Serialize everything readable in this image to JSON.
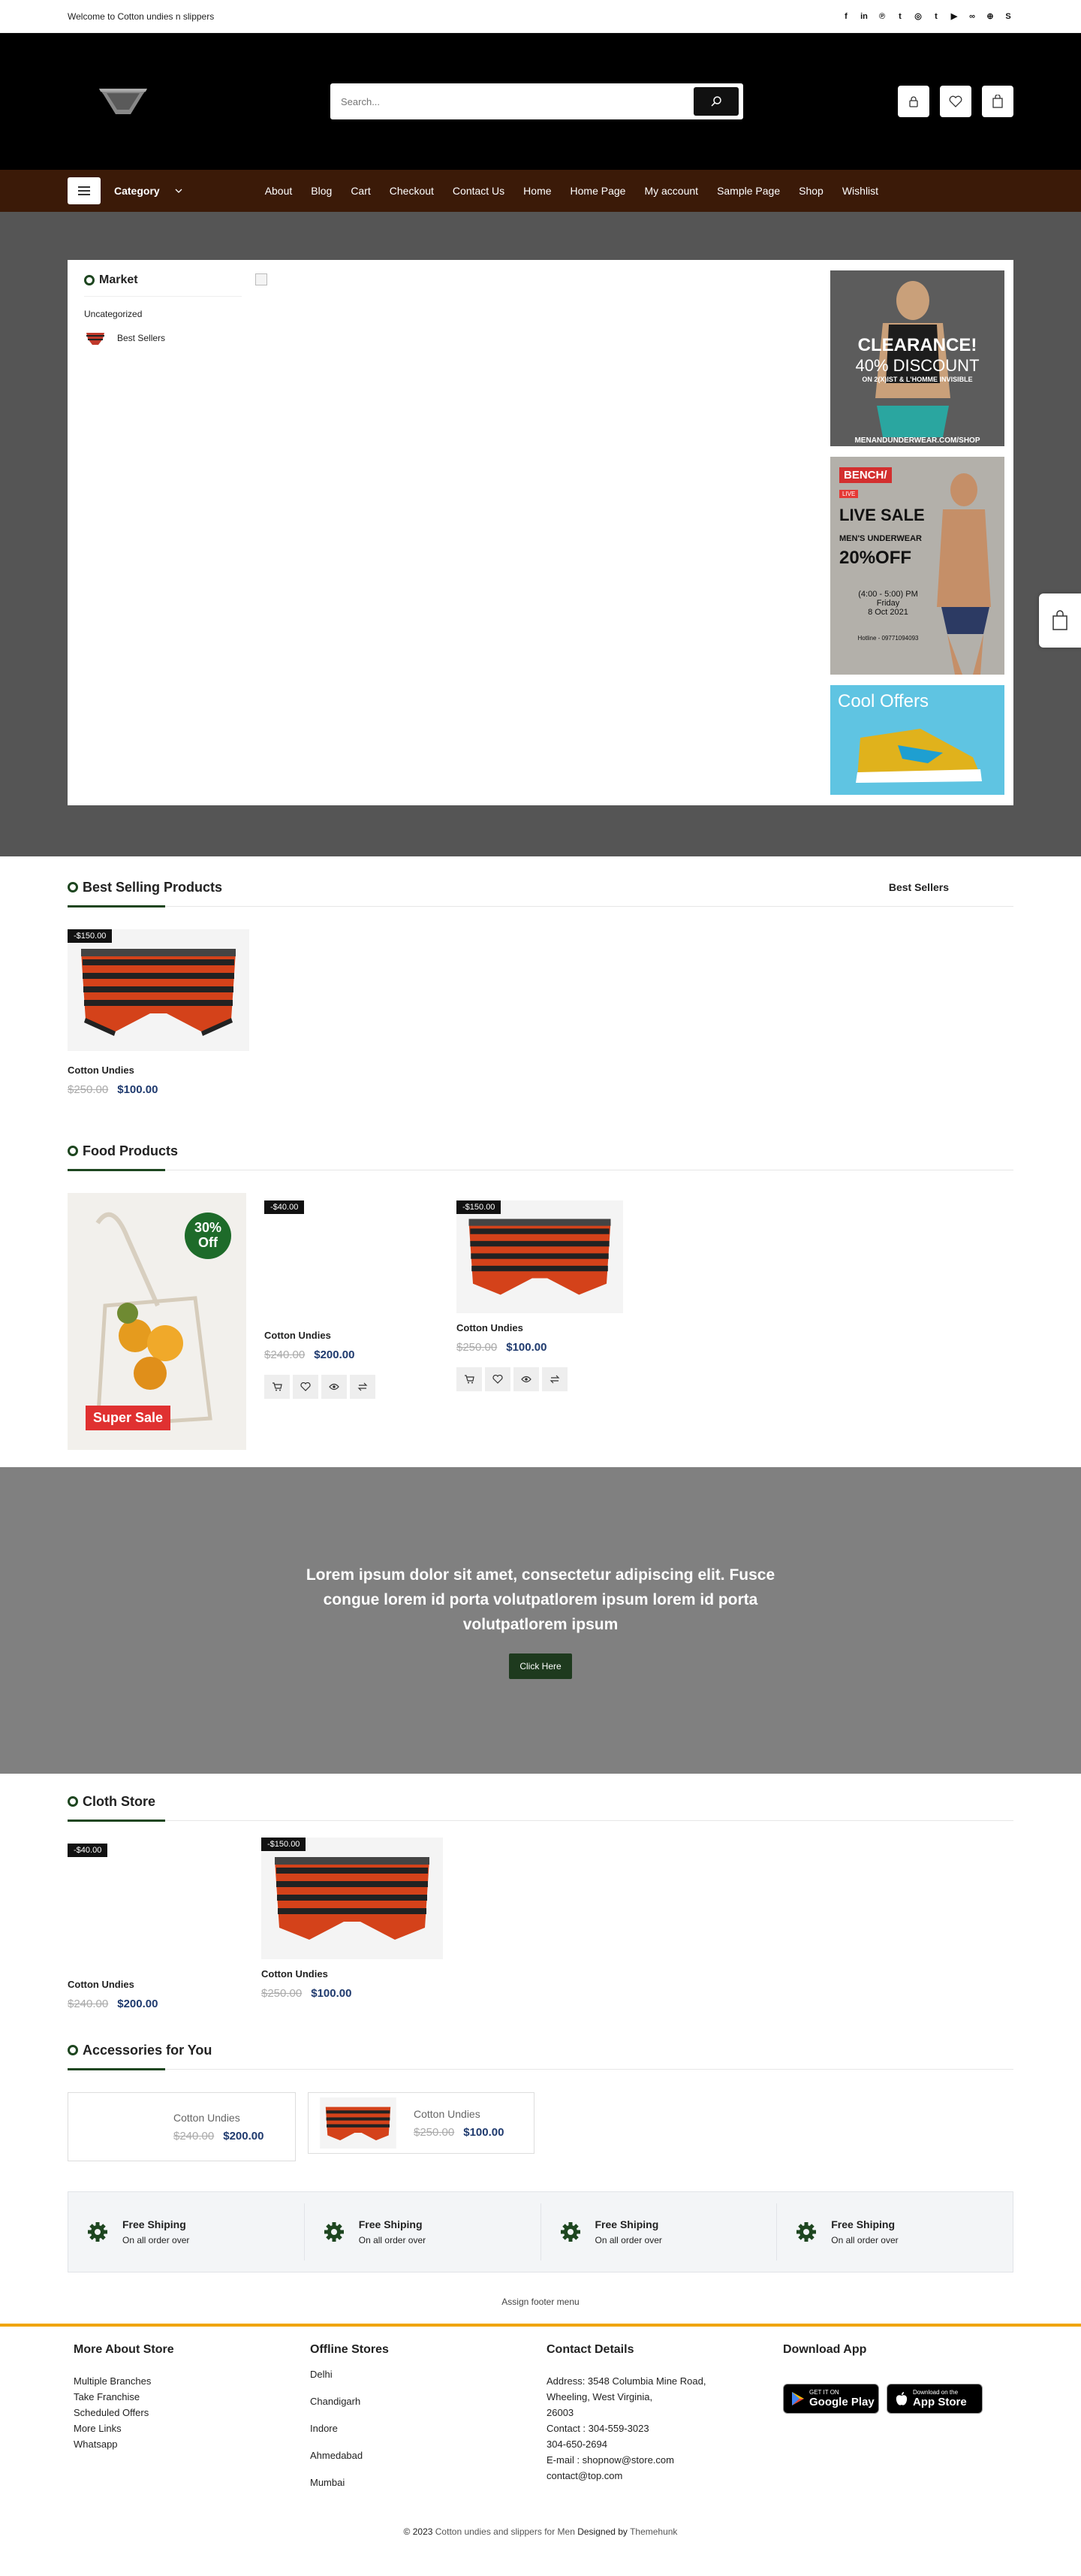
{
  "topbar": {
    "welcome": "Welcome to Cotton undies n slippers"
  },
  "social_icons": [
    "facebook-icon",
    "linkedin-icon",
    "pinterest-icon",
    "twitter-icon",
    "instagram-icon",
    "tumblr-icon",
    "youtube-icon",
    "flickr-icon",
    "dribbble-icon",
    "skype-icon"
  ],
  "header": {
    "search_placeholder": "Search..."
  },
  "nav": {
    "category_label": "Category",
    "links": [
      "About",
      "Blog",
      "Cart",
      "Checkout",
      "Contact Us",
      "Home",
      "Home Page",
      "My account",
      "Sample Page",
      "Shop",
      "Wishlist"
    ]
  },
  "market": {
    "title": "Market",
    "uncategorized": "Uncategorized",
    "best_sellers": "Best Sellers"
  },
  "ads": {
    "ad1": {
      "line1": "CLEARANCE!",
      "line2": "40% DISCOUNT",
      "line3": "ON 2(X)IST & L'HOMME INVISIBLE",
      "url": "MENANDUNDERWEAR.COM/SHOP"
    },
    "ad2": {
      "brand": "BENCH/",
      "live": "LIVE",
      "title": "LIVE SALE",
      "sub": "MEN'S UNDERWEAR",
      "off": "20%OFF",
      "time": "(4:00 - 5:00) PM",
      "day": "Friday",
      "date": "8 Oct 2021",
      "hotline": "Hotline - 09771094093"
    },
    "ad3": {
      "title": "Cool Offers"
    }
  },
  "best_selling": {
    "title": "Best Selling Products",
    "tab": "Best Sellers",
    "products": [
      {
        "badge": "-$150.00",
        "name": "Cotton Undies",
        "old": "$250.00",
        "new": "$100.00"
      }
    ]
  },
  "food": {
    "title": "Food Products",
    "promo": {
      "pct": "30%",
      "off": "Off",
      "label": "Super Sale"
    },
    "products": [
      {
        "badge": "-$40.00",
        "name": "Cotton Undies",
        "old": "$240.00",
        "new": "$200.00"
      },
      {
        "badge": "-$150.00",
        "name": "Cotton Undies",
        "old": "$250.00",
        "new": "$100.00"
      }
    ]
  },
  "banner": {
    "text": "Lorem ipsum dolor sit amet, consectetur adipiscing elit. Fusce congue lorem id porta volutpatlorem ipsum lorem id porta volutpatlorem ipsum",
    "button": "Click Here"
  },
  "cloth": {
    "title": "Cloth Store",
    "products": [
      {
        "badge": "-$40.00",
        "name": "Cotton Undies",
        "old": "$240.00",
        "new": "$200.00"
      },
      {
        "badge": "-$150.00",
        "name": "Cotton Undies",
        "old": "$250.00",
        "new": "$100.00"
      }
    ]
  },
  "accessories": {
    "title": "Accessories for You",
    "items": [
      {
        "name": "Cotton Undies",
        "old": "$240.00",
        "new": "$200.00"
      },
      {
        "name": "Cotton Undies",
        "old": "$250.00",
        "new": "$100.00"
      }
    ]
  },
  "features": [
    {
      "title": "Free Shiping",
      "sub": "On all order over"
    },
    {
      "title": "Free Shiping",
      "sub": "On all order over"
    },
    {
      "title": "Free Shiping",
      "sub": "On all order over"
    },
    {
      "title": "Free Shiping",
      "sub": "On all order over"
    }
  ],
  "footer_menu": "Assign footer menu",
  "footer": {
    "about": {
      "title": "More About Store",
      "items": [
        "Multiple Branches",
        "Take Franchise",
        "Scheduled Offers",
        "More Links",
        "Whatsapp"
      ]
    },
    "offline": {
      "title": "Offline Stores",
      "items": [
        "Delhi",
        "Chandigarh",
        "Indore",
        "Ahmedabad",
        "Mumbai"
      ]
    },
    "contact": {
      "title": "Contact Details",
      "items": [
        "Address: 3548 Columbia Mine Road,",
        "Wheeling, West Virginia,",
        "26003",
        "Contact : 304-559-3023",
        "304-650-2694",
        "E-mail : shopnow@store.com",
        "contact@top.com"
      ]
    },
    "app": {
      "title": "Download App",
      "google_small": "GET IT ON",
      "google": "Google Play",
      "apple_small": "Download on the",
      "apple": "App Store"
    }
  },
  "copyright": {
    "year": "© 2023",
    "site": "Cotton undies and slippers for Men",
    "designed": "Designed by",
    "author": "Themehunk"
  },
  "colors": {
    "accent": "#1e4620",
    "nav_bg": "#3b1a08",
    "price": "#1f3a6e",
    "footer_border": "#f0a500"
  }
}
